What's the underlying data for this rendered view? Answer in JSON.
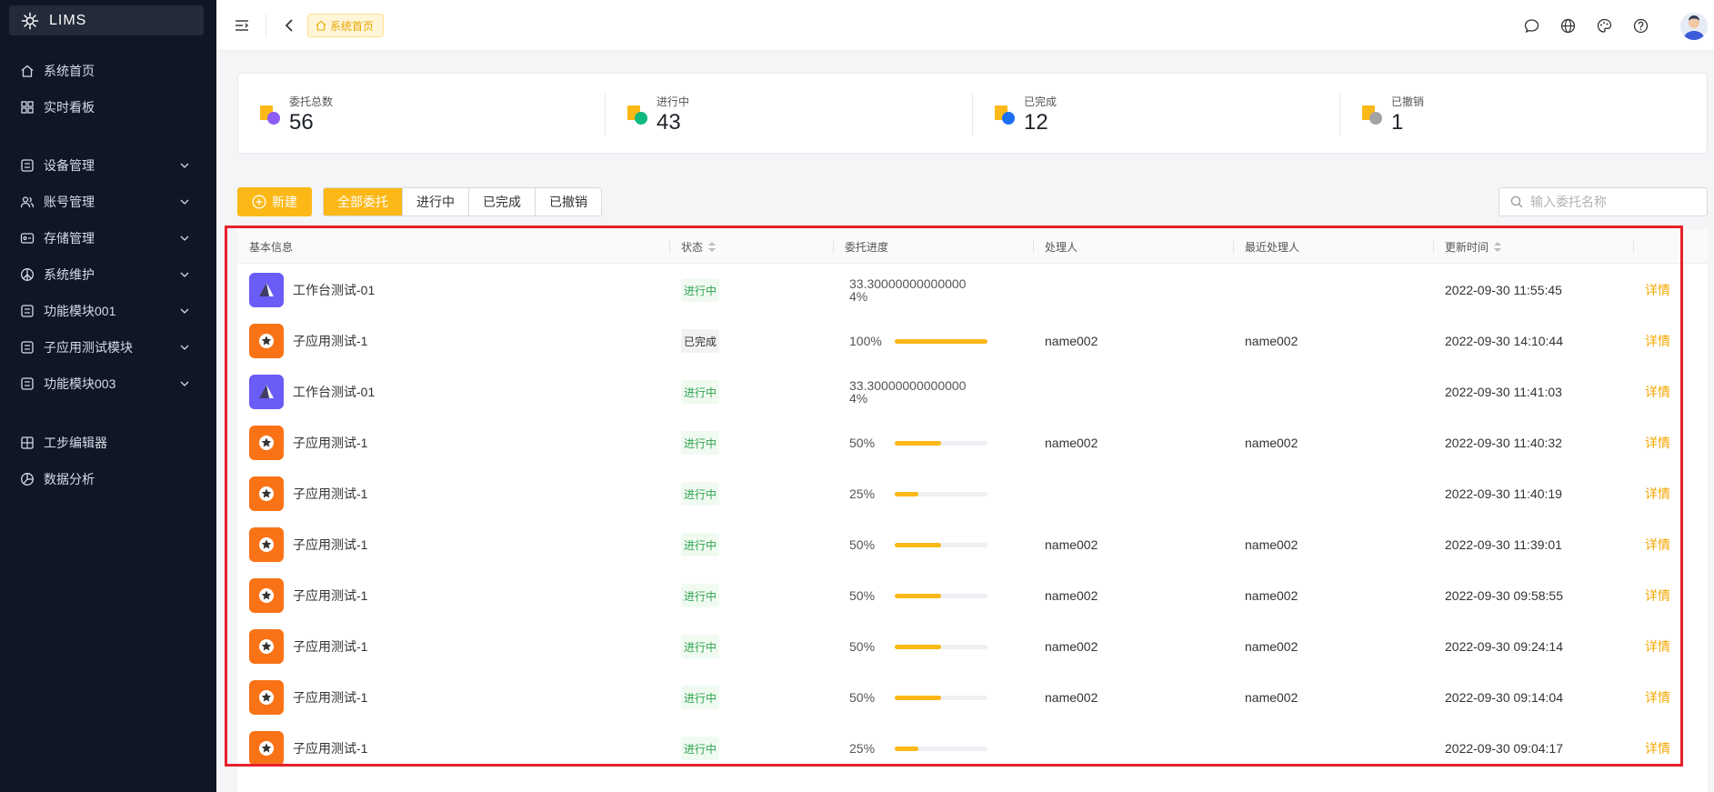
{
  "app": {
    "title": "LIMS"
  },
  "sidebar": {
    "items": [
      {
        "label": "系统首页",
        "icon": "home-icon"
      },
      {
        "label": "实时看板",
        "icon": "dashboard-icon"
      },
      {
        "label": "设备管理",
        "icon": "table-icon"
      },
      {
        "label": "账号管理",
        "icon": "users-icon"
      },
      {
        "label": "存储管理",
        "icon": "storage-icon"
      },
      {
        "label": "系统维护",
        "icon": "peace-icon"
      },
      {
        "label": "功能模块001",
        "icon": "table-icon"
      },
      {
        "label": "子应用测试模块",
        "icon": "table-icon"
      },
      {
        "label": "功能模块003",
        "icon": "table-icon"
      },
      {
        "label": "工步编辑器",
        "icon": "grid-icon"
      },
      {
        "label": "数据分析",
        "icon": "chart-icon"
      }
    ]
  },
  "header": {
    "breadcrumb": "系统首页"
  },
  "stats": [
    {
      "label": "委托总数",
      "value": "56",
      "color": "#8b5cf6"
    },
    {
      "label": "进行中",
      "value": "43",
      "color": "#10b981"
    },
    {
      "label": "已完成",
      "value": "12",
      "color": "#1d6ff2"
    },
    {
      "label": "已撤销",
      "value": "1",
      "color": "#a3a3a3"
    }
  ],
  "toolbar": {
    "new_label": "新建",
    "filters": [
      "全部委托",
      "进行中",
      "已完成",
      "已撤销"
    ],
    "search_placeholder": "输入委托名称"
  },
  "table": {
    "columns": [
      "基本信息",
      "状态",
      "委托进度",
      "处理人",
      "最近处理人",
      "更新时间"
    ],
    "detail_label": "详情",
    "rows": [
      {
        "name": "工作台测试-01",
        "icon": "purple",
        "status": "进行中",
        "progress_text": "33.30000000000000\n4%",
        "progress": null,
        "handler": "",
        "recent": "",
        "updated": "2022-09-30 11:55:45"
      },
      {
        "name": "子应用测试-1",
        "icon": "orange",
        "status": "已完成",
        "progress_text": "100%",
        "progress": 1.0,
        "handler": "name002",
        "recent": "name002",
        "updated": "2022-09-30 14:10:44"
      },
      {
        "name": "工作台测试-01",
        "icon": "purple",
        "status": "进行中",
        "progress_text": "33.30000000000000\n4%",
        "progress": null,
        "handler": "",
        "recent": "",
        "updated": "2022-09-30 11:41:03"
      },
      {
        "name": "子应用测试-1",
        "icon": "orange",
        "status": "进行中",
        "progress_text": "50%",
        "progress": 0.5,
        "handler": "name002",
        "recent": "name002",
        "updated": "2022-09-30 11:40:32"
      },
      {
        "name": "子应用测试-1",
        "icon": "orange",
        "status": "进行中",
        "progress_text": "25%",
        "progress": 0.25,
        "handler": "",
        "recent": "",
        "updated": "2022-09-30 11:40:19"
      },
      {
        "name": "子应用测试-1",
        "icon": "orange",
        "status": "进行中",
        "progress_text": "50%",
        "progress": 0.5,
        "handler": "name002",
        "recent": "name002",
        "updated": "2022-09-30 11:39:01"
      },
      {
        "name": "子应用测试-1",
        "icon": "orange",
        "status": "进行中",
        "progress_text": "50%",
        "progress": 0.5,
        "handler": "name002",
        "recent": "name002",
        "updated": "2022-09-30 09:58:55"
      },
      {
        "name": "子应用测试-1",
        "icon": "orange",
        "status": "进行中",
        "progress_text": "50%",
        "progress": 0.5,
        "handler": "name002",
        "recent": "name002",
        "updated": "2022-09-30 09:24:14"
      },
      {
        "name": "子应用测试-1",
        "icon": "orange",
        "status": "进行中",
        "progress_text": "50%",
        "progress": 0.5,
        "handler": "name002",
        "recent": "name002",
        "updated": "2022-09-30 09:14:04"
      },
      {
        "name": "子应用测试-1",
        "icon": "orange",
        "status": "进行中",
        "progress_text": "25%",
        "progress": 0.25,
        "handler": "",
        "recent": "",
        "updated": "2022-09-30 09:04:17"
      }
    ]
  }
}
